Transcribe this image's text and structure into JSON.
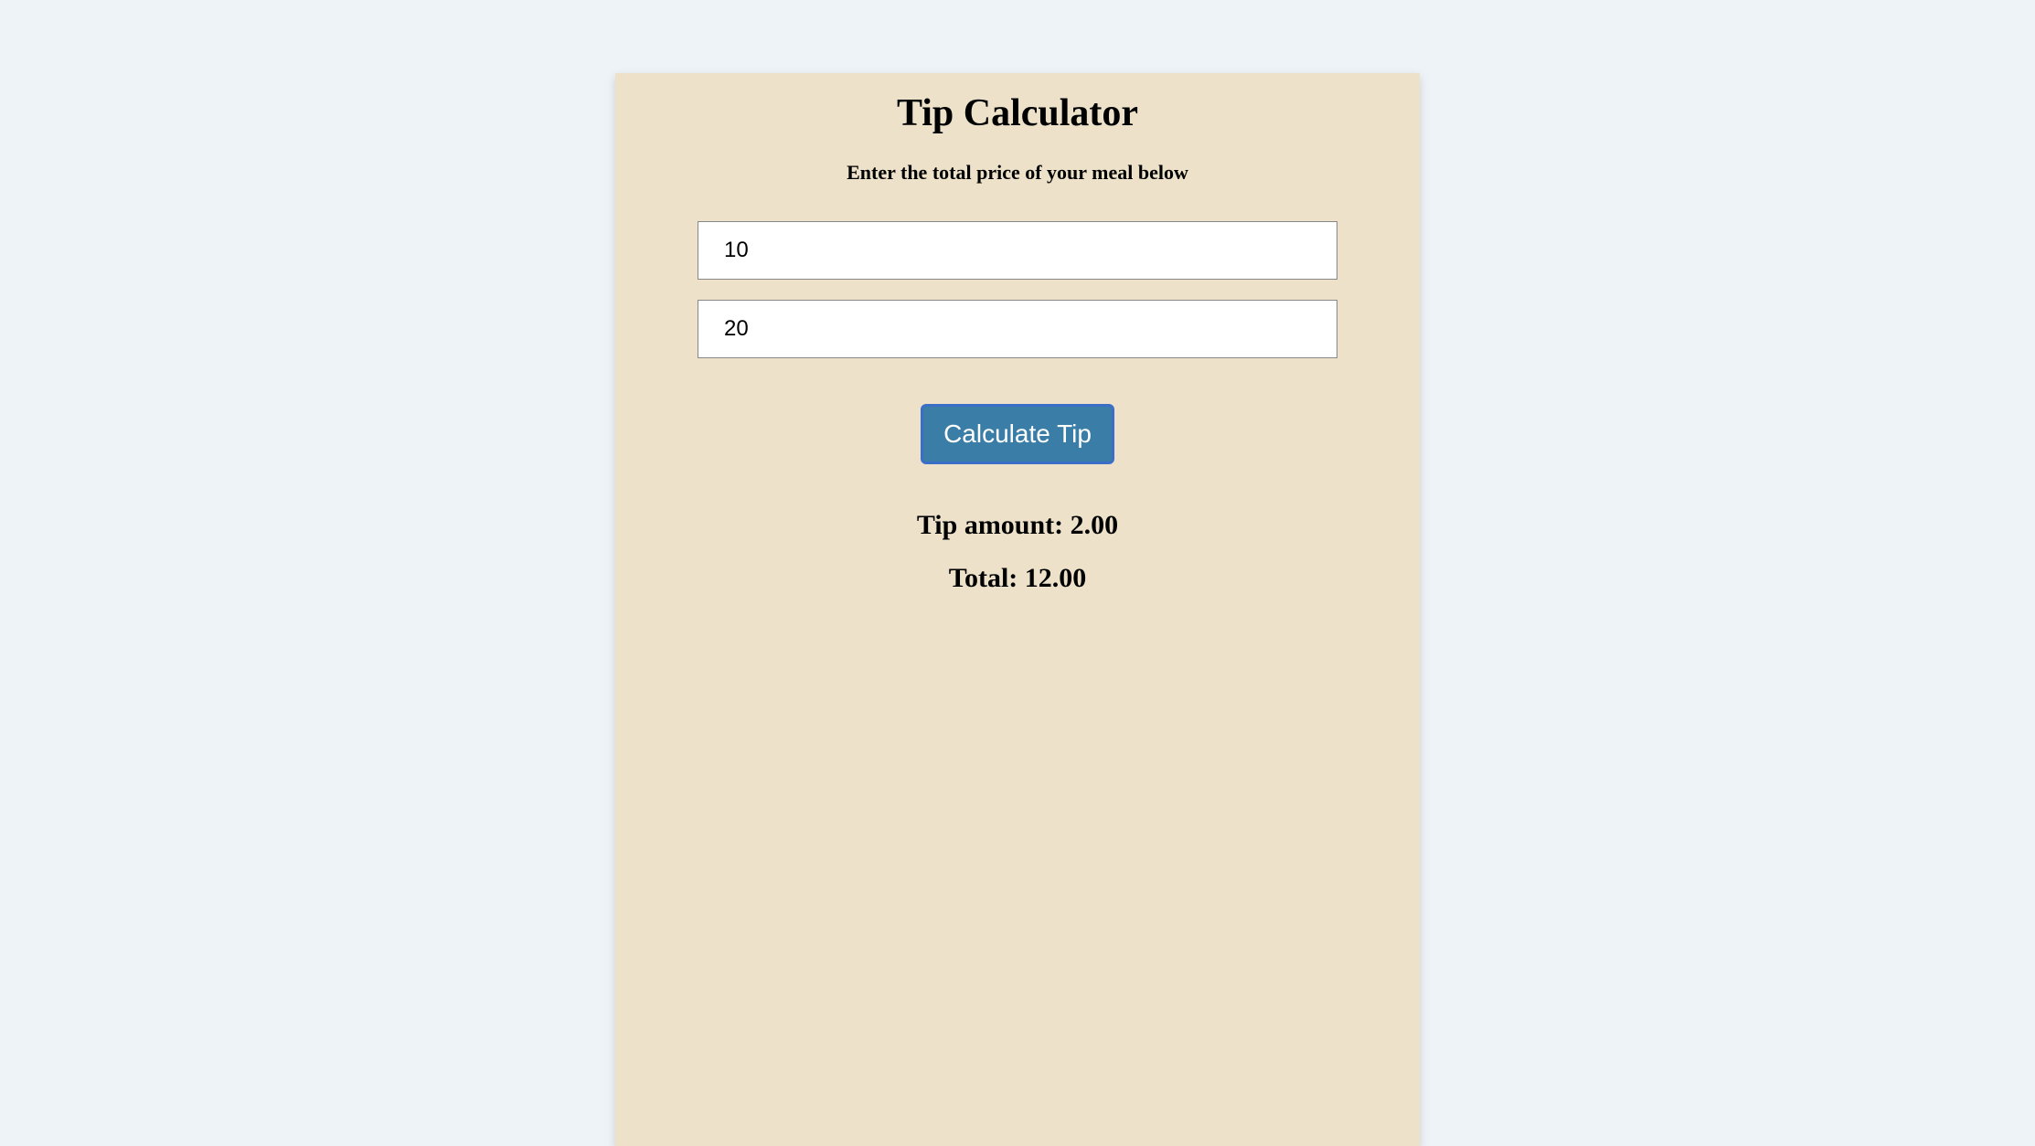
{
  "title": "Tip Calculator",
  "subtitle": "Enter the total price of your meal below",
  "inputs": {
    "meal_price": "10",
    "tip_percent": "20"
  },
  "button_label": "Calculate Tip",
  "results": {
    "tip_label": "Tip amount: ",
    "tip_value": "2.00",
    "total_label": "Total: ",
    "total_value": "12.00"
  }
}
